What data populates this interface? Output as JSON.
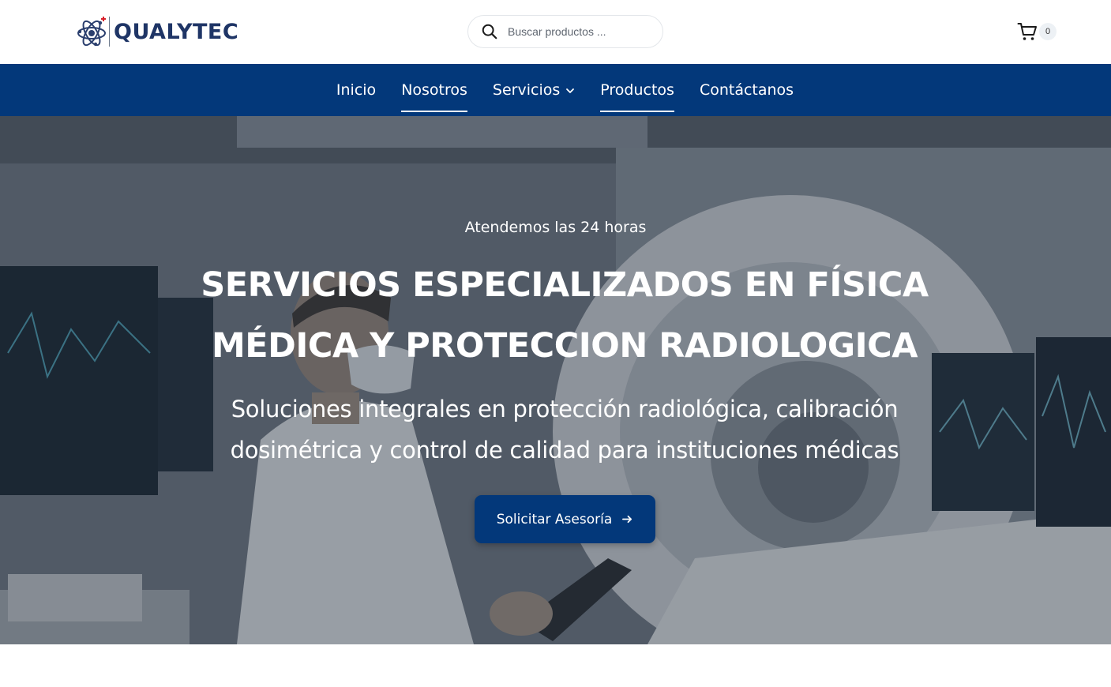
{
  "header": {
    "logo_text": "QUALYTEC",
    "search": {
      "placeholder": "Buscar productos ..."
    },
    "cart": {
      "count": "0"
    }
  },
  "nav": {
    "items": [
      {
        "label": "Inicio",
        "active": false
      },
      {
        "label": "Nosotros",
        "active": true
      },
      {
        "label": "Servicios",
        "active": false,
        "has_dropdown": true
      },
      {
        "label": "Productos",
        "active": true
      },
      {
        "label": "Contáctanos",
        "active": false
      }
    ]
  },
  "hero": {
    "eyebrow": "Atendemos las 24 horas",
    "title_line1": "SERVICIOS ESPECIALIZADOS EN FÍSICA",
    "title_line2": "MÉDICA Y PROTECCION RADIOLOGICA",
    "subtitle_line1": "Soluciones integrales en protección radiológica, calibración",
    "subtitle_line2": "dosimétrica y control de calidad para instituciones médicas",
    "cta_label": "Solicitar Asesoría"
  },
  "colors": {
    "primary": "#03387a",
    "logo_text": "#1f3566",
    "white": "#ffffff",
    "search_border": "#e3e6ea",
    "badge_bg": "#edf1f5"
  },
  "icons": [
    "atom-logo-icon",
    "search-icon",
    "cart-icon",
    "chevron-down-icon",
    "arrow-right-icon"
  ]
}
